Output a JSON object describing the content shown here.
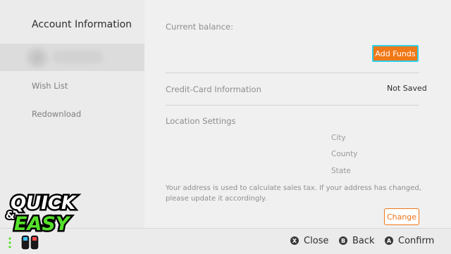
{
  "sidebar": {
    "title": "Account Information",
    "items": [
      {
        "label": "Wish List"
      },
      {
        "label": "Redownload"
      }
    ]
  },
  "main": {
    "current_balance_label": "Current balance:",
    "add_funds_label": "Add Funds",
    "credit_card_label": "Credit-Card Information",
    "credit_card_value": "Not Saved",
    "location_label": "Location Settings",
    "address_fields": [
      "City",
      "County",
      "State"
    ],
    "address_note": "Your address is used to calculate sales tax. If your address has changed, please update it accordingly.",
    "change_label": "Change"
  },
  "footer": {
    "buttons": [
      {
        "key": "X",
        "label": "Close"
      },
      {
        "key": "B",
        "label": "Back"
      },
      {
        "key": "A",
        "label": "Confirm"
      }
    ]
  },
  "overlay": {
    "line1": "QUICK",
    "amp": "&",
    "line2": "EASY"
  },
  "colors": {
    "accent": "#f07818",
    "focus": "#2cd0e8",
    "logo_green": "#55e02a"
  }
}
